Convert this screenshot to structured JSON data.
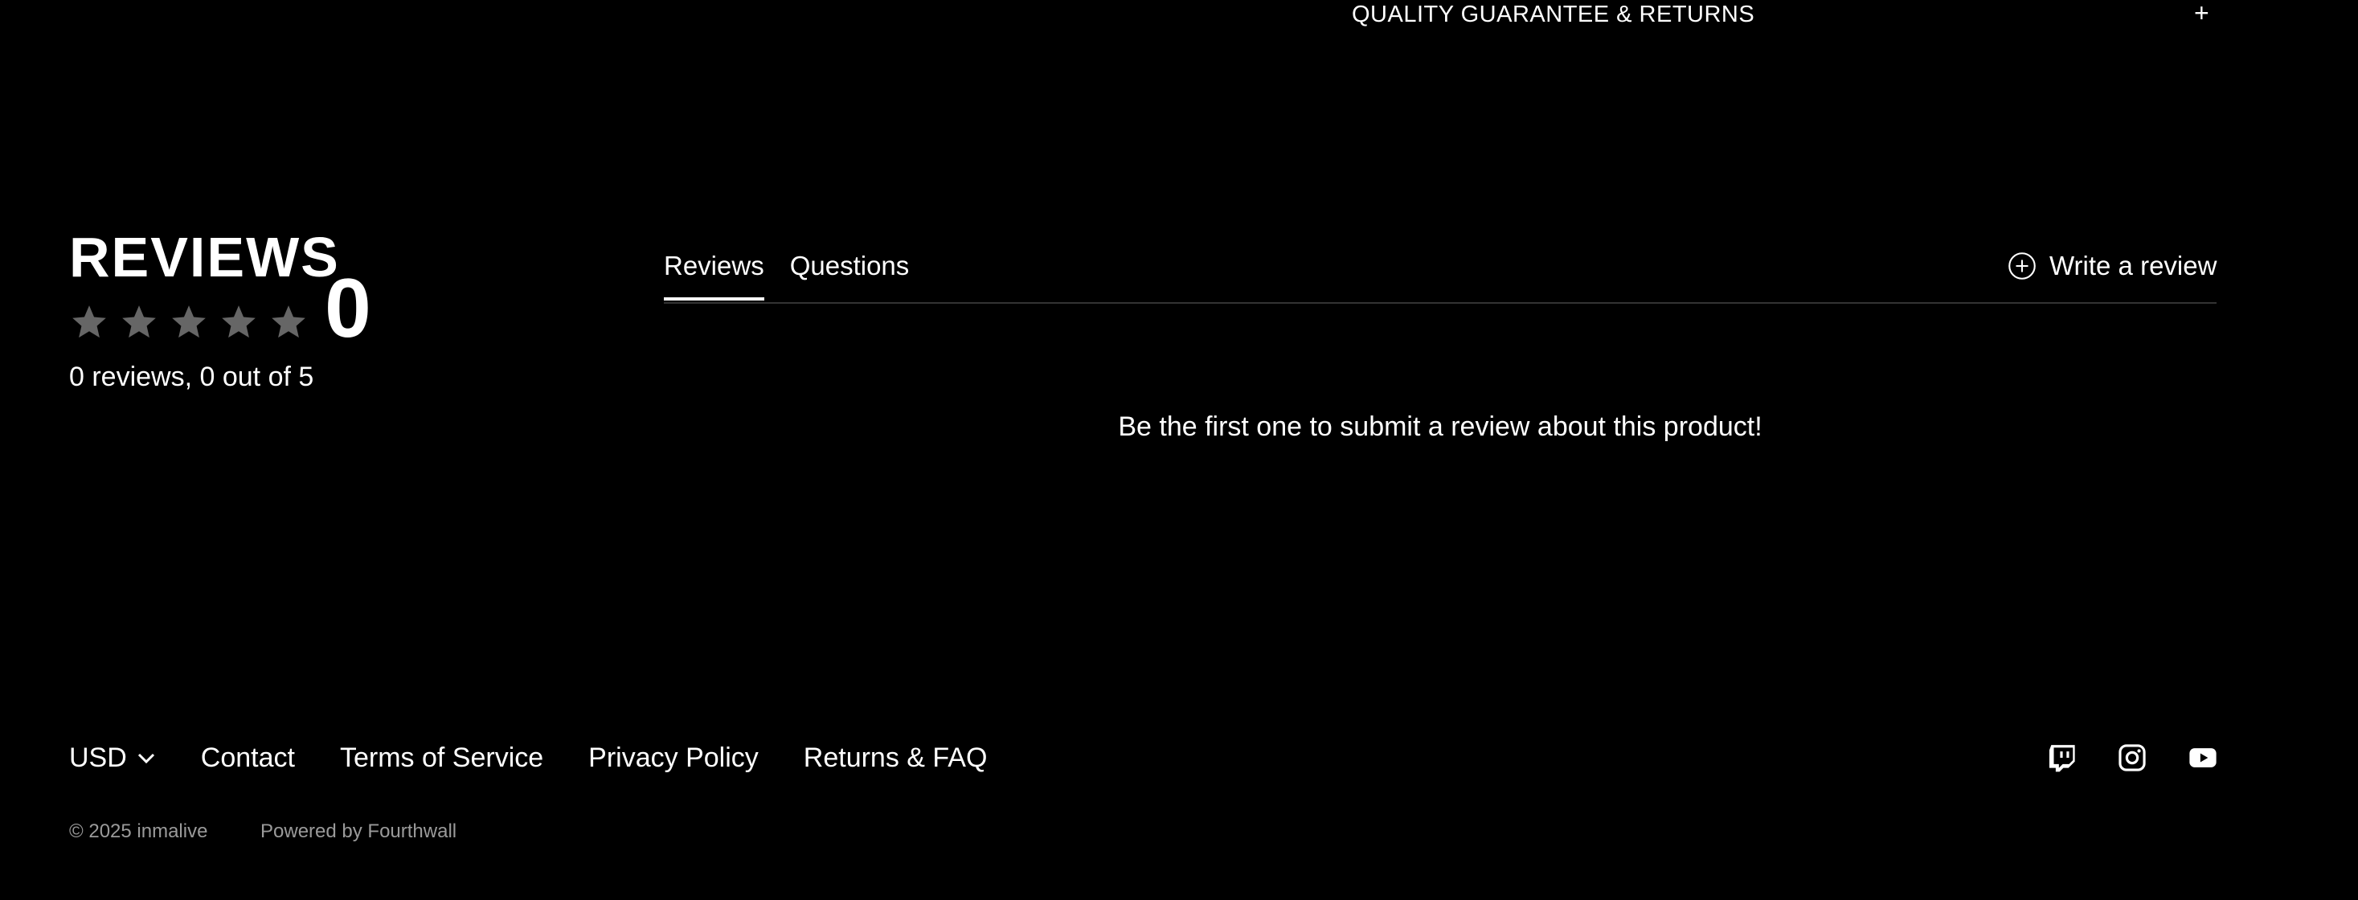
{
  "accordion": {
    "title": "QUALITY GUARANTEE & RETURNS",
    "toggle_symbol": "+",
    "toggle_icon": "plus-icon"
  },
  "reviews_summary": {
    "heading": "REVIEWS",
    "average_rating": "0",
    "rating_out_of": 5,
    "filled_stars": 0,
    "count_text": "0 reviews, 0 out of 5",
    "star_color_empty": "#666666"
  },
  "tabs": {
    "reviews_label": "Reviews",
    "questions_label": "Questions",
    "active": "Reviews"
  },
  "write_review": {
    "label": "Write a review",
    "icon": "plus-circle-icon"
  },
  "empty_state": {
    "message": "Be the first one to submit a review about this product!"
  },
  "footer": {
    "currency_selected": "USD",
    "currency_icon": "chevron-down-icon",
    "links": [
      "Contact",
      "Terms of Service",
      "Privacy Policy",
      "Returns & FAQ"
    ],
    "social": [
      "twitch-icon",
      "instagram-icon",
      "youtube-icon"
    ],
    "copyright": "© 2025 inmalive",
    "powered_by": "Powered by Fourthwall"
  },
  "colors": {
    "background": "#000000",
    "text": "#ffffff",
    "muted_text": "#9a9a9a",
    "divider": "#333333"
  }
}
